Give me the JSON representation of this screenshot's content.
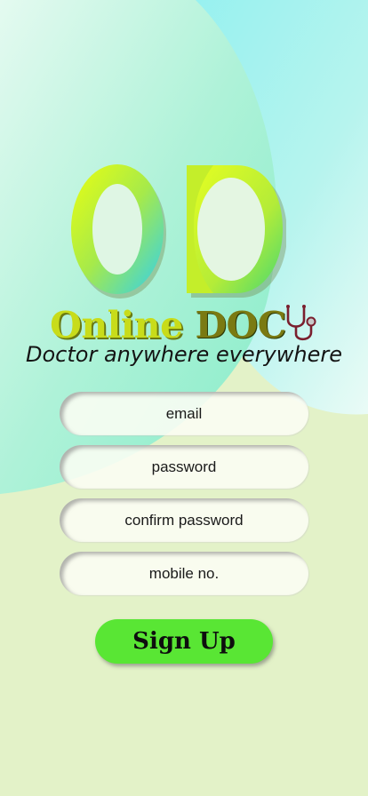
{
  "brand": {
    "logo_monogram": "OD",
    "name_part1": "Online",
    "name_part2": "DOC"
  },
  "tagline": "Doctor anywhere everywhere",
  "form": {
    "email_placeholder": "email",
    "password_placeholder": "password",
    "confirm_password_placeholder": "confirm password",
    "mobile_placeholder": "mobile no."
  },
  "signup_label": "Sign Up",
  "icons": {
    "logo": "od-logo-icon",
    "stethoscope": "stethoscope-icon"
  },
  "colors": {
    "background": "#e3f2c8",
    "top_right_blob": "#a8f2ef",
    "top_left_blob": "#8eeecb",
    "field_fill": "#fcfdf4",
    "signup_button": "#59e634",
    "logo_gradient_start": "#eaff10",
    "logo_gradient_end": "#2fd0f0",
    "brand_text_1": "#c8dc1a",
    "brand_text_2": "#7a7a12"
  }
}
